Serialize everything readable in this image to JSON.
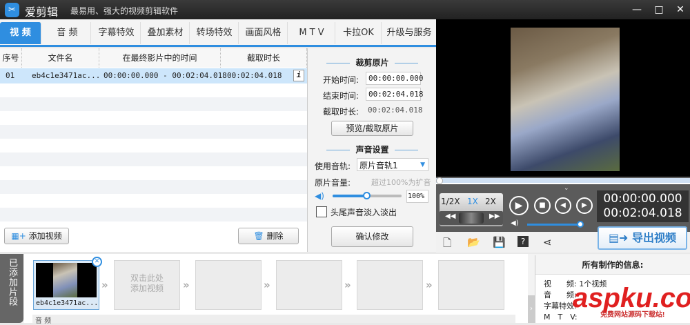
{
  "app": {
    "name": "爱剪辑",
    "subtitle": "最易用、强大的视频剪辑软件"
  },
  "window": {
    "minimize": "—",
    "maximize": "□",
    "close": "✕"
  },
  "tabs": [
    "视 频",
    "音 频",
    "字幕特效",
    "叠加素材",
    "转场特效",
    "画面风格",
    "M T V",
    "卡拉OK",
    "升级与服务"
  ],
  "table": {
    "headers": [
      "序号",
      "文件名",
      "在最终影片中的时间",
      "截取时长"
    ],
    "rows": [
      {
        "index": "01",
        "file": "eb4c1e3471ac...",
        "range": "00:00:00.000 - 00:02:04.018",
        "duration": "00:02:04.018"
      }
    ]
  },
  "left_buttons": {
    "add": "添加视频",
    "delete": "删除"
  },
  "crop": {
    "title": "裁剪原片",
    "start_label": "开始时间:",
    "start": "00:00:00.000",
    "end_label": "结束时间:",
    "end": "00:02:04.018",
    "dur_label": "截取时长:",
    "dur": "00:02:04.018",
    "preview_btn": "预览/截取原片"
  },
  "audio": {
    "title": "声音设置",
    "track_label": "使用音轨:",
    "track": "原片音轨1",
    "volume_label": "原片音量:",
    "hint": "超过100%为扩音",
    "volume": "100%",
    "volume_fraction": 0.5,
    "fade_label": "头尾声音淡入淡出",
    "fade_checked": false,
    "confirm_btn": "确认修改"
  },
  "player": {
    "speeds": [
      "1/2X",
      "1X",
      "2X"
    ],
    "active_speed": "1X",
    "current": "00:00:00.000",
    "total": "00:02:04.018",
    "progress": 0.0,
    "volume_fraction": 1.0
  },
  "export": "导出视频",
  "bottom": {
    "label": "已添加片段",
    "clips": [
      {
        "name": "eb4c1e3471ac..."
      }
    ],
    "placeholder": "双击此处\n添加视频",
    "audio_track": "音 频"
  },
  "info": {
    "title": "所有制作的信息:",
    "items": [
      {
        "k": "视　　频:",
        "v": "1个视频"
      },
      {
        "k": "音　　频:",
        "v": ""
      },
      {
        "k": "字幕特效:",
        "v": ""
      },
      {
        "k": "M　T　V:",
        "v": ""
      }
    ]
  },
  "watermark": {
    "text": "aspku.com",
    "sub": "免费网站源码下载站!"
  },
  "colors": {
    "accent": "#2f8ee0",
    "selected_row": "#cde6fb"
  }
}
